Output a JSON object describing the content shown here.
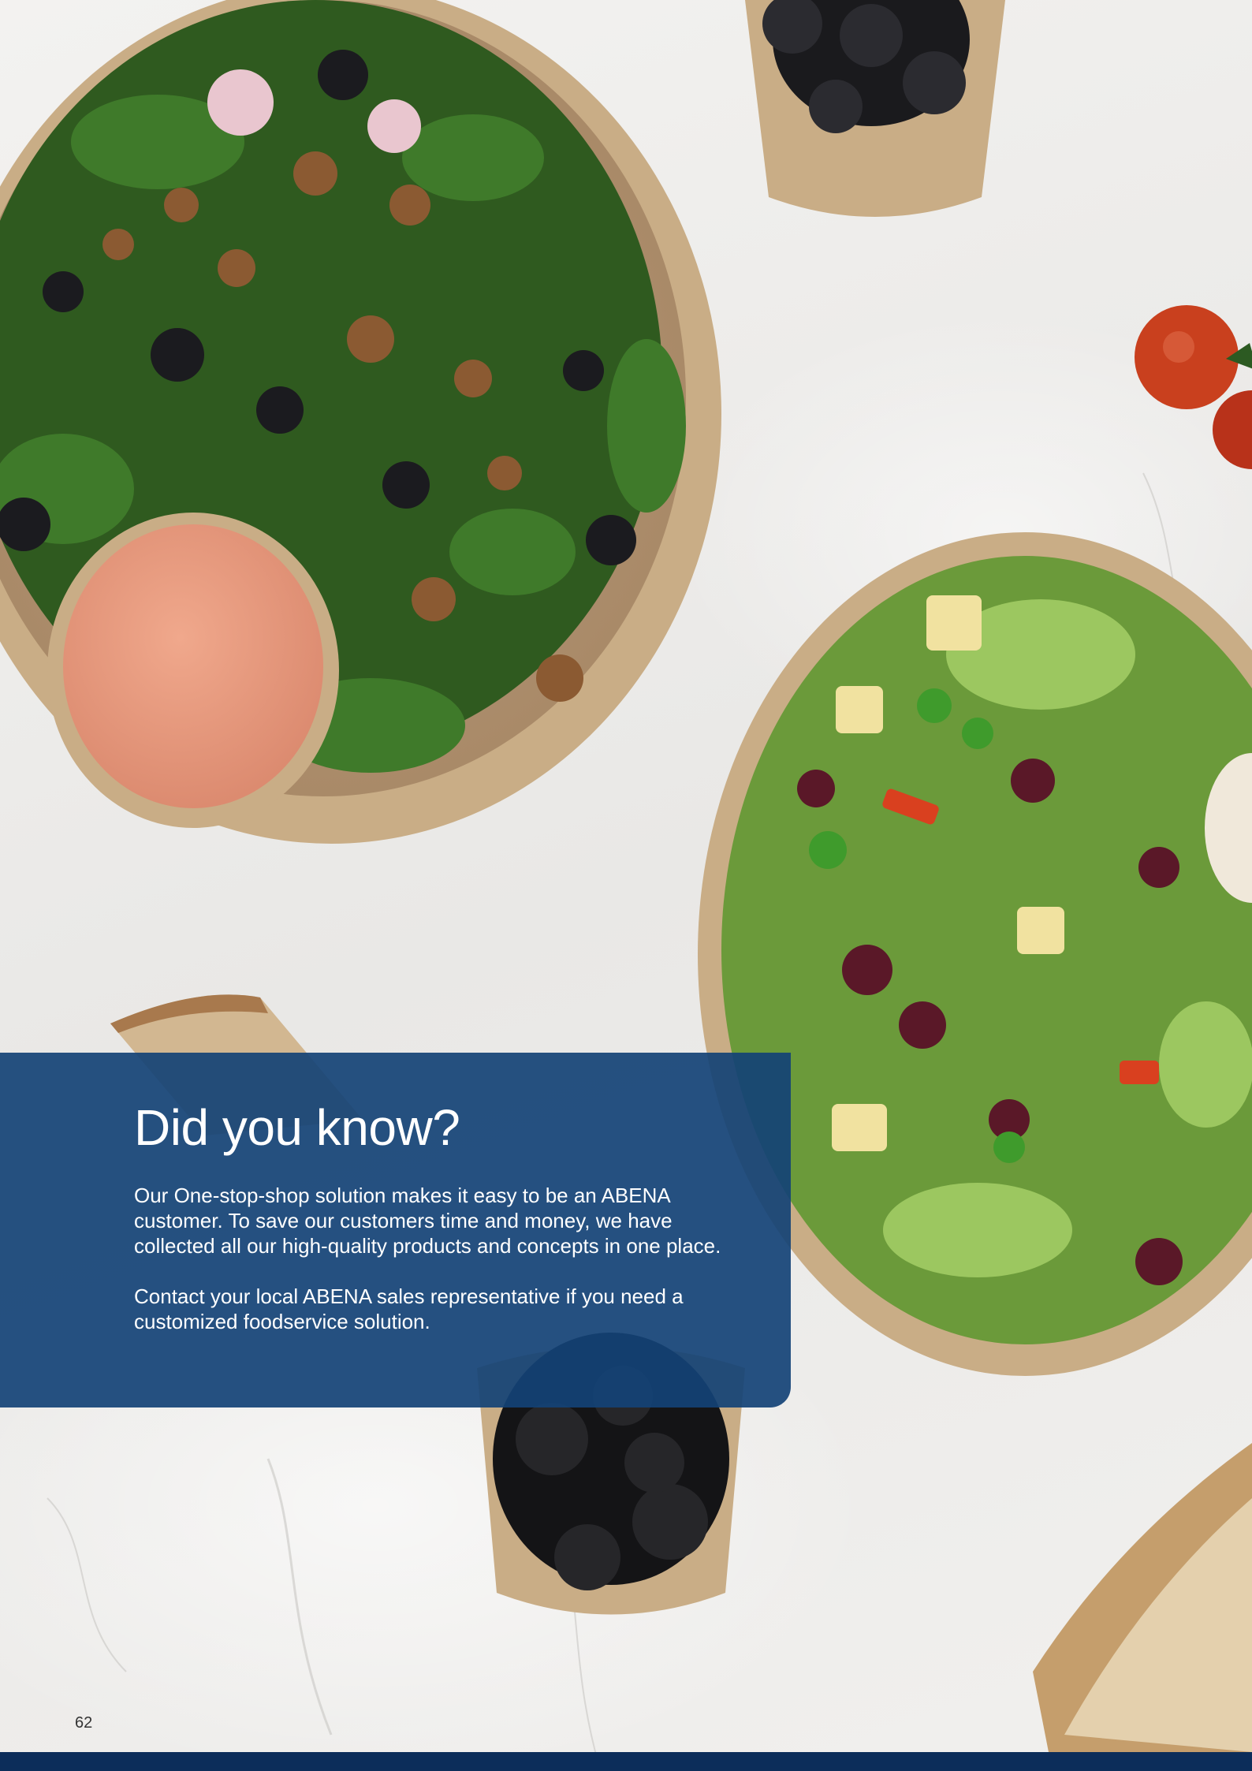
{
  "info_box": {
    "title": "Did you know?",
    "paragraph_1": "Our One-stop-shop solution makes it easy to be an ABENA customer. To save our customers time and money, we have collected all our high-quality products and concepts in one place.",
    "paragraph_2": "Contact your local ABENA sales representative if you need a customized foodservice solution."
  },
  "page_number": "62",
  "colors": {
    "panel": "#144276",
    "footer": "#0c2d5a",
    "kraft": "#c9ad86"
  }
}
